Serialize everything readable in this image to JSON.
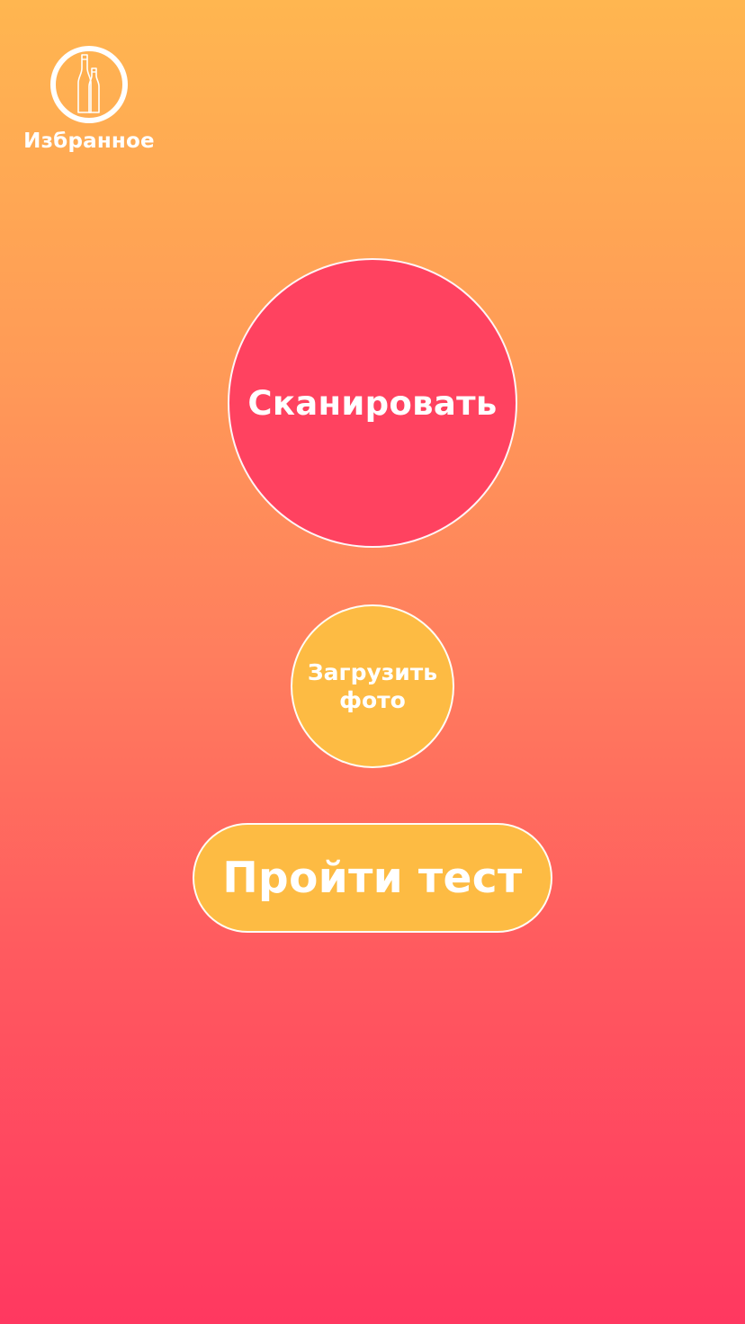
{
  "colors": {
    "gradient_top": "#FFB650",
    "gradient_bottom": "#FF3860",
    "scan_button": "#FF4260",
    "secondary_button": "#FDBB43",
    "text": "#FFFFFF"
  },
  "favorites": {
    "icon": "bottles-icon",
    "label": "Избранное"
  },
  "scan_button": {
    "label": "Сканировать"
  },
  "upload_button": {
    "label_line1": "Загрузить",
    "label_line2": "фото"
  },
  "test_button": {
    "label": "Пройти тест"
  }
}
